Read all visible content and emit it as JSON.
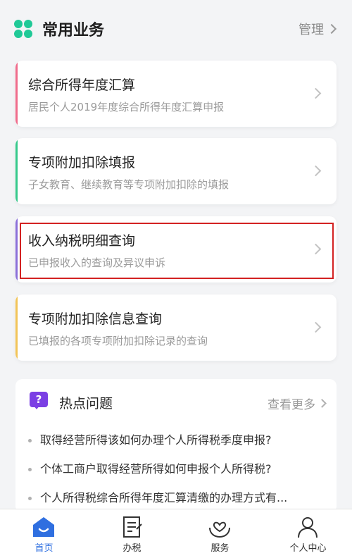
{
  "header": {
    "title": "常用业务",
    "manage_label": "管理"
  },
  "cards": [
    {
      "title": "综合所得年度汇算",
      "subtitle": "居民个人2019年度综合所得年度汇算申报",
      "accent": "#f06b8b"
    },
    {
      "title": "专项附加扣除填报",
      "subtitle": "子女教育、继续教育等专项附加扣除的填报",
      "accent": "#35c98b"
    },
    {
      "title": "收入纳税明细查询",
      "subtitle": "已申报收入的查询及异议申诉",
      "accent": "#8b6fd9"
    },
    {
      "title": "专项附加扣除信息查询",
      "subtitle": "已填报的各项专项附加扣除记录的查询",
      "accent": "#f2c457"
    }
  ],
  "hot": {
    "icon_label": "?",
    "title": "热点问题",
    "more_label": "查看更多",
    "questions": [
      "取得经营所得该如何办理个人所得税季度申报?",
      "个体工商户取得经营所得如何申报个人所得税?",
      "个人所得税综合所得年度汇算清缴的办理方式有..."
    ]
  },
  "tabs": [
    {
      "label": "首页",
      "icon": "home-icon",
      "active": true
    },
    {
      "label": "办税",
      "icon": "tax-form-icon",
      "active": false
    },
    {
      "label": "服务",
      "icon": "heart-hands-icon",
      "active": false
    },
    {
      "label": "个人中心",
      "icon": "person-icon",
      "active": false
    }
  ],
  "colors": {
    "brand": "#20c997",
    "active_tab": "#2f6fe0",
    "highlight_border": "#d32222"
  }
}
